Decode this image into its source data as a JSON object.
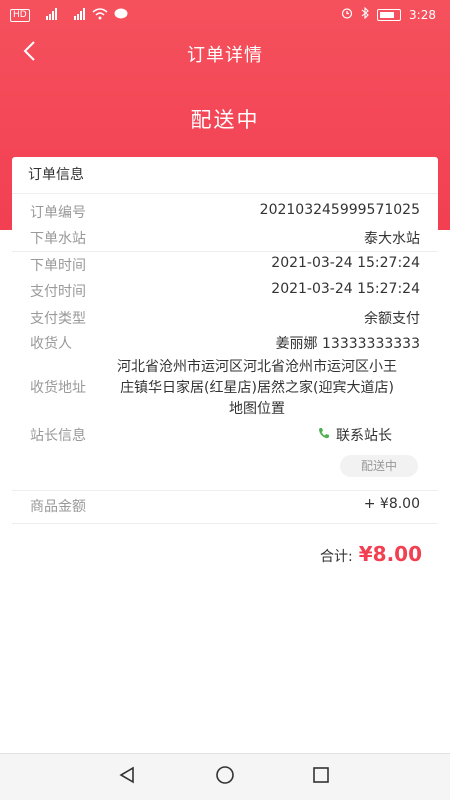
{
  "status_bar": {
    "network_badge": "HD",
    "signal1": "4G",
    "signal2": "4G",
    "time": "3:28"
  },
  "header": {
    "title": "订单详情",
    "order_status": "配送中"
  },
  "order_info": {
    "section_title": "订单信息",
    "order_number_label": "订单编号",
    "order_number": "202103245999571025",
    "station_label": "下单水站",
    "station": "泰大水站",
    "order_time_label": "下单时间",
    "order_time": "2021-03-24 15:27:24",
    "pay_time_label": "支付时间",
    "pay_time": "2021-03-24 15:27:24",
    "pay_type_label": "支付类型",
    "pay_type": "余额支付",
    "receiver_label": "收货人",
    "receiver": "姜丽娜 13333333333",
    "address_label": "收货地址",
    "address_line1": "河北省沧州市运河区河北省沧州市运河区小王",
    "address_line2": "庄镇华日家居(红星店)居然之家(迎宾大道店)",
    "address_line3": "地图位置",
    "manager_label": "站长信息",
    "contact_manager": "联系站长",
    "delivery_badge": "配送中",
    "goods_amount_label": "商品金额",
    "goods_amount": "+ ¥8.00"
  },
  "summary": {
    "total_label": "合计:",
    "total_value": "¥8.00"
  },
  "colors": {
    "accent": "#f23f52",
    "phone_icon": "#4caf50"
  }
}
